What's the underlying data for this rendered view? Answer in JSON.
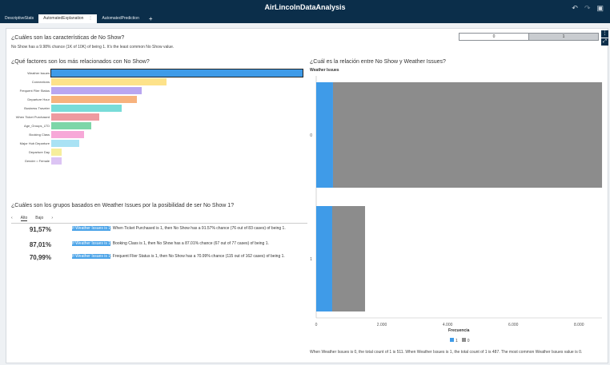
{
  "app": {
    "title": "AirLincolnDataAnalysis"
  },
  "tabs": [
    {
      "label": "DescriptiveStats"
    },
    {
      "label": "AutomatedExplanation"
    },
    {
      "label": "AutomatedPrediction"
    }
  ],
  "icons": {
    "undo": "undo-icon",
    "redo": "redo-icon",
    "save": "save-icon",
    "add_tab": "plus-icon",
    "close": "close-icon"
  },
  "toggle": {
    "opt0": "0",
    "opt1": "1",
    "selected": "1"
  },
  "characteristics": {
    "title": "¿Cuáles son las características de No Show?",
    "text": "No Show has a 9.98% chance (1K of 10K) of being 1. It's the least common No Show value."
  },
  "factors": {
    "title": "¿Qué factores son los más relacionados con No Show?",
    "items": [
      {
        "label": "Weather Issues",
        "color": "#3f9be8",
        "value": 100
      },
      {
        "label": "Connections",
        "color": "#fde28a",
        "value": 46
      },
      {
        "label": "Frequent Flier Status",
        "color": "#b9a6f0",
        "value": 36
      },
      {
        "label": "Departure Hour",
        "color": "#f7b27d",
        "value": 34
      },
      {
        "label": "Business Traveler",
        "color": "#78dcd8",
        "value": 28
      },
      {
        "label": "When Ticket Purchased",
        "color": "#ee9aa0",
        "value": 19
      },
      {
        "label": "Age_Groups_LTD",
        "color": "#7dd6a8",
        "value": 16
      },
      {
        "label": "Booking Class",
        "color": "#f7a8d8",
        "value": 13
      },
      {
        "label": "Major Hub Departure",
        "color": "#a9e2f4",
        "value": 11
      },
      {
        "label": "Departure Day",
        "color": "#f6ee9c",
        "value": 4
      },
      {
        "label": "Gender = Female",
        "color": "#dcc4f4",
        "value": 4
      }
    ]
  },
  "groups": {
    "title": "¿Cuáles son los grupos basados en Weather Issues por la posibilidad de ser No Show 1?",
    "tabs": [
      "Alto",
      "Bajo"
    ],
    "rows": [
      {
        "pct": "91,57%",
        "hl": "If Weather Issues is 1",
        "text": ". When Ticket Purchased is 1, then No Show has a 91.57% chance (76 out of 83 cases) of being 1."
      },
      {
        "pct": "87,01%",
        "hl": "If Weather Issues is 1",
        "text": ". Booking Class is 1, then No Show has a 87.01% chance (67 out of 77 cases) of being 1."
      },
      {
        "pct": "70,99%",
        "hl": "If Weather Issues is 1",
        "text": ". Frequent Flier Status is 1, then No Show has a 70.99% chance (115 out of 162 cases) of being 1."
      }
    ]
  },
  "relation": {
    "title": "¿Cuál es la relación entre No Show y Weather Issues?",
    "footer": "When Weather Issues is 0, the total count of 1 is 511. When Weather Issues is 1, the total count of 1 is 487. The most common Weather Issues value is 0."
  },
  "chart_data": {
    "type": "bar",
    "orientation": "horizontal",
    "stacked": true,
    "ylabel": "Weather Issues",
    "xlabel": "Frecuencia",
    "categories": [
      "0",
      "1"
    ],
    "series": [
      {
        "name": "1",
        "color": "#3f9be8",
        "values": [
          511,
          487
        ]
      },
      {
        "name": "0",
        "color": "#8c8c8c",
        "values": [
          8190,
          1000
        ]
      }
    ],
    "xticks": [
      "0",
      "2.000",
      "4.000",
      "6.000",
      "8.000"
    ],
    "xlim": [
      0,
      8700
    ],
    "legend": "bottom"
  }
}
